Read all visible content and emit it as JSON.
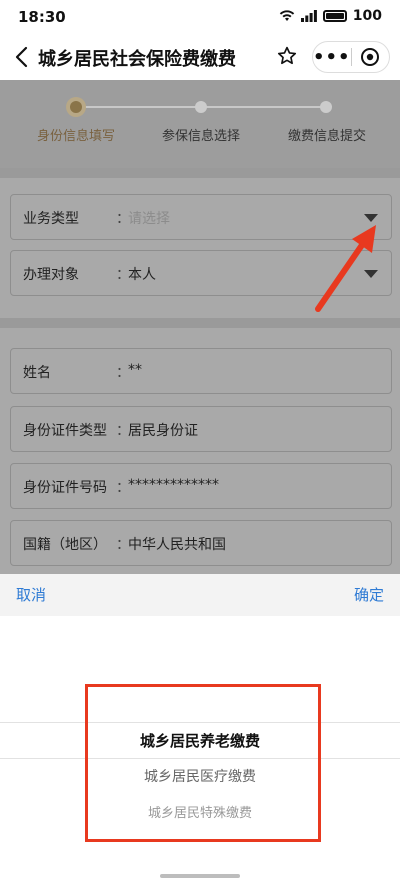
{
  "status": {
    "time": "18:30",
    "battery": "100"
  },
  "nav": {
    "title": "城乡居民社会保险费缴费",
    "more": "•••"
  },
  "steps": [
    {
      "label": "身份信息填写",
      "active": true
    },
    {
      "label": "参保信息选择",
      "active": false
    },
    {
      "label": "缴费信息提交",
      "active": false
    }
  ],
  "form": {
    "business_type": {
      "label": "业务类型",
      "colon": "：",
      "placeholder": "请选择"
    },
    "handle_target": {
      "label": "办理对象",
      "colon": "：",
      "value": "本人"
    },
    "name": {
      "label": "姓名",
      "colon": "：",
      "value": "**"
    },
    "id_type": {
      "label": "身份证件类型",
      "colon": "：",
      "value": "居民身份证"
    },
    "id_number": {
      "label": "身份证件号码",
      "colon": "：",
      "value": "*************"
    },
    "nationality": {
      "label": "国籍（地区）",
      "colon": "：",
      "value": "中华人民共和国"
    }
  },
  "picker": {
    "cancel": "取消",
    "confirm": "确定",
    "options": [
      "城乡居民养老缴费",
      "城乡居民医疗缴费",
      "城乡居民特殊缴费"
    ],
    "selected_index": 0
  },
  "colors": {
    "link": "#2f7bd4",
    "step_active": "#7a6240",
    "annotation_red": "#e8391f"
  }
}
